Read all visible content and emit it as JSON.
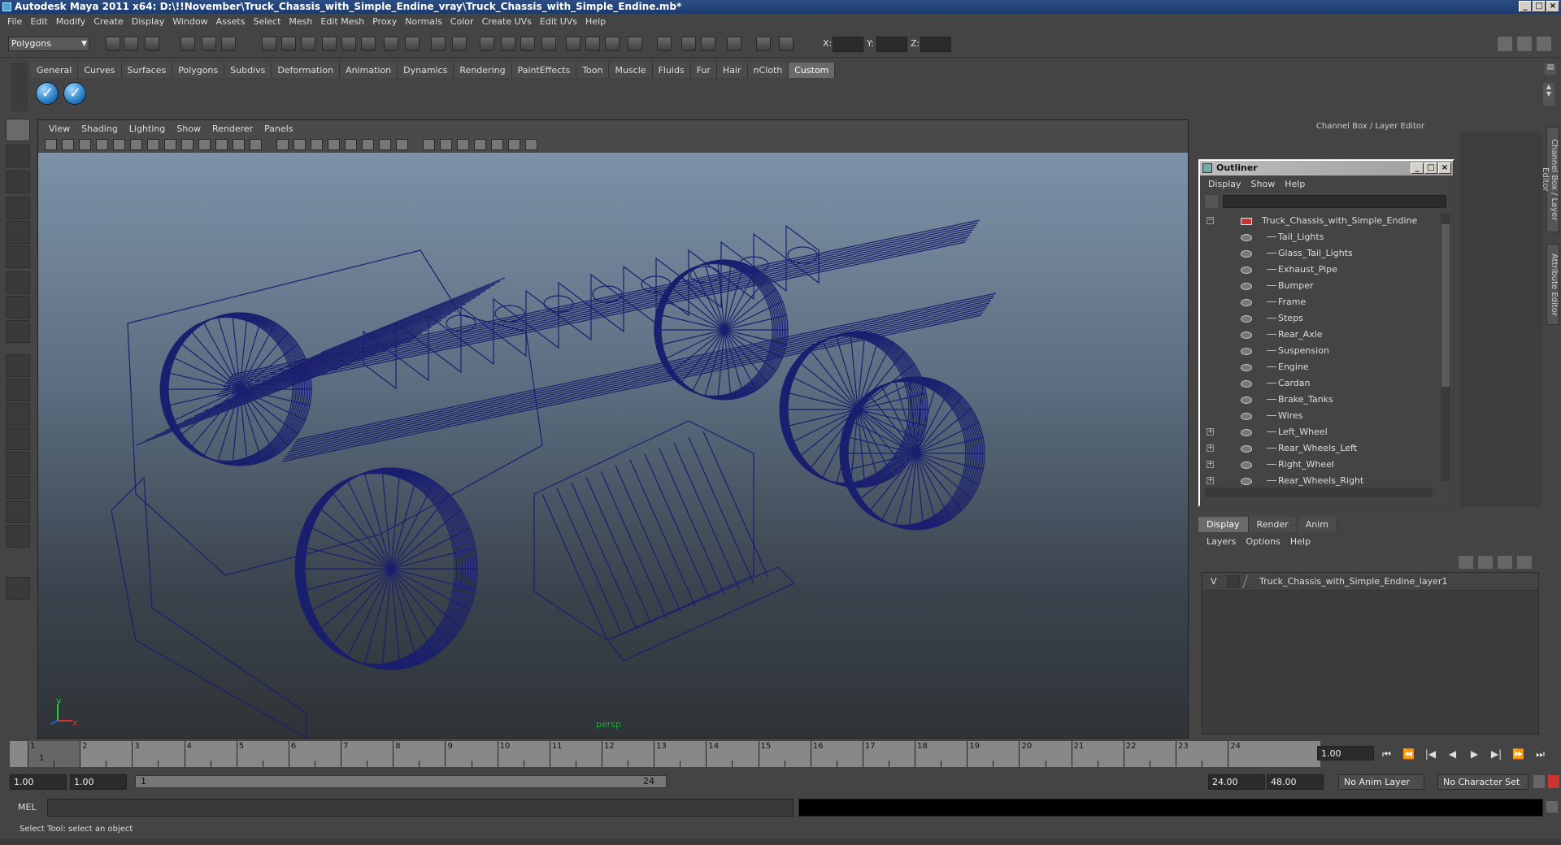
{
  "window": {
    "title": "Autodesk Maya 2011 x64: D:\\!!November\\Truck_Chassis_with_Simple_Endine_vray\\Truck_Chassis_with_Simple_Endine.mb*",
    "buttons": [
      "_",
      "□",
      "×"
    ]
  },
  "menubar": [
    "File",
    "Edit",
    "Modify",
    "Create",
    "Display",
    "Window",
    "Assets",
    "Select",
    "Mesh",
    "Edit Mesh",
    "Proxy",
    "Normals",
    "Color",
    "Create UVs",
    "Edit UVs",
    "Help"
  ],
  "statusline": {
    "mode": "Polygons",
    "xyz": {
      "x": "X:",
      "y": "Y:",
      "z": "Z:"
    }
  },
  "shelf": {
    "tabs": [
      "General",
      "Curves",
      "Surfaces",
      "Polygons",
      "Subdivs",
      "Deformation",
      "Animation",
      "Dynamics",
      "Rendering",
      "PaintEffects",
      "Toon",
      "Muscle",
      "Fluids",
      "Fur",
      "Hair",
      "nCloth",
      "Custom"
    ],
    "active_tab": "Custom"
  },
  "viewport": {
    "menu": [
      "View",
      "Shading",
      "Lighting",
      "Show",
      "Renderer",
      "Panels"
    ],
    "camera": "persp",
    "axes": {
      "y": "y",
      "x": "x",
      "z": "z"
    }
  },
  "channel_box": {
    "title": "Channel Box / Layer Editor",
    "side_tabs": [
      "Channel Box / Layer Editor",
      "Attribute Editor"
    ]
  },
  "outliner": {
    "title": "Outliner",
    "menu": [
      "Display",
      "Show",
      "Help"
    ],
    "buttons": [
      "_",
      "□",
      "×"
    ],
    "root": "Truck_Chassis_with_Simple_Endine",
    "items": [
      {
        "name": "Tail_Lights",
        "expandable": false
      },
      {
        "name": "Glass_Tail_Lights",
        "expandable": false
      },
      {
        "name": "Exhaust_Pipe",
        "expandable": false
      },
      {
        "name": "Bumper",
        "expandable": false
      },
      {
        "name": "Frame",
        "expandable": false
      },
      {
        "name": "Steps",
        "expandable": false
      },
      {
        "name": "Rear_Axle",
        "expandable": false
      },
      {
        "name": "Suspension",
        "expandable": false
      },
      {
        "name": "Engine",
        "expandable": false
      },
      {
        "name": "Cardan",
        "expandable": false
      },
      {
        "name": "Brake_Tanks",
        "expandable": false
      },
      {
        "name": "Wires",
        "expandable": false
      },
      {
        "name": "Left_Wheel",
        "expandable": true
      },
      {
        "name": "Rear_Wheels_Left",
        "expandable": true
      },
      {
        "name": "Right_Wheel",
        "expandable": true
      },
      {
        "name": "Rear_Wheels_Right",
        "expandable": true
      }
    ]
  },
  "layer_editor": {
    "tabs": [
      "Display",
      "Render",
      "Anim"
    ],
    "active_tab": "Display",
    "menu": [
      "Layers",
      "Options",
      "Help"
    ],
    "layer": {
      "visible": "V",
      "name": "Truck_Chassis_with_Simple_Endine_layer1"
    }
  },
  "timeline": {
    "ticks": [
      "1",
      "2",
      "3",
      "4",
      "5",
      "6",
      "7",
      "8",
      "9",
      "10",
      "11",
      "12",
      "13",
      "14",
      "15",
      "16",
      "17",
      "18",
      "19",
      "20",
      "21",
      "22",
      "23",
      "24"
    ],
    "current_frame_marker": "1",
    "current_time": "1.00"
  },
  "range": {
    "start": "1.00",
    "playback_start": "1.00",
    "slider_start": "1",
    "slider_end": "24",
    "playback_end": "24.00",
    "end": "48.00",
    "anim_layer": "No Anim Layer",
    "character_set": "No Character Set"
  },
  "playback_buttons": [
    "⏮",
    "⏪",
    "|◀",
    "◀",
    "▶",
    "▶|",
    "⏩",
    "⏭"
  ],
  "mel": {
    "label": "MEL"
  },
  "helpline": "Select Tool: select an object",
  "colors": {
    "wireframe": "#1a1f6e",
    "accent": "#2c4e84"
  }
}
